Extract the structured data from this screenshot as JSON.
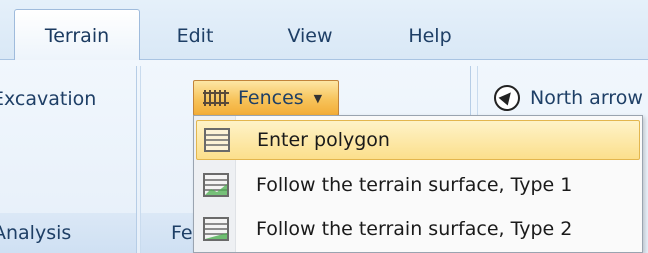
{
  "tabs": [
    {
      "label": "Terrain",
      "active": true
    },
    {
      "label": "Edit"
    },
    {
      "label": "View"
    },
    {
      "label": "Help"
    }
  ],
  "ribbon": {
    "group1": {
      "button_label": "Excavation",
      "group_label": "Analysis"
    },
    "group2": {
      "button_label": "Fences",
      "group_label": "Fe"
    },
    "group3": {
      "button_label": "North arrow"
    }
  },
  "menu": {
    "items": [
      {
        "label": "Enter polygon",
        "icon": "polygon-fence-icon",
        "highlighted": true
      },
      {
        "label": "Follow the terrain surface, Type 1",
        "icon": "terrain-fence-type1-icon"
      },
      {
        "label": "Follow the terrain surface, Type 2",
        "icon": "terrain-fence-type2-icon"
      }
    ]
  },
  "colors": {
    "accent_highlight": "#fcdf8c",
    "ribbon_background": "#e6eff9",
    "text": "#1e3f66"
  }
}
